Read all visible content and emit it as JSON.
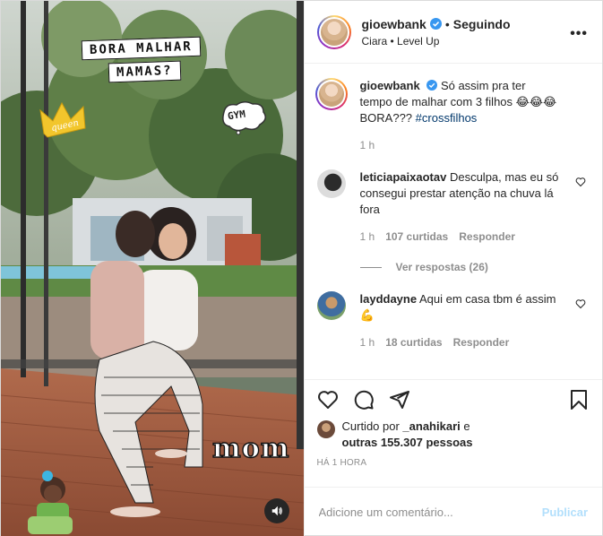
{
  "media": {
    "sticker_line1": "BORA MALHAR",
    "sticker_line2": "MAMAS?",
    "sticker_gym": "GYM",
    "sticker_queen": "queen",
    "sticker_mom": "mom"
  },
  "header": {
    "username": "gioewbank",
    "separator": "•",
    "follow_status": "Seguindo",
    "song": "Ciara • Level Up",
    "more_icon": "more-horizontal-icon"
  },
  "caption": {
    "username": "gioewbank",
    "text": "Só assim pra ter tempo de malhar com 3 filhos 😂😂😂 BORA??? ",
    "hashtag": "#crossfilhos",
    "time": "1 h"
  },
  "comments": [
    {
      "username": "leticiapaixaotav",
      "text": "Desculpa, mas eu só consegui prestar atenção na chuva lá fora",
      "time": "1 h",
      "likes": "107 curtidas",
      "reply": "Responder",
      "view_replies": "Ver respostas (26)"
    },
    {
      "username": "layddayne",
      "text": "Aqui em casa tbm é assim💪",
      "time": "1 h",
      "likes": "18 curtidas",
      "reply": "Responder"
    }
  ],
  "likes": {
    "prefix": "Curtido por ",
    "user": "_anahikari",
    "middle": " e ",
    "others": "outras 155.307 pessoas"
  },
  "posted_ago": "HÁ 1 HORA",
  "add_comment": {
    "placeholder": "Adicione um comentário...",
    "publish_label": "Publicar"
  },
  "colors": {
    "link": "#00376b",
    "publish_disabled": "#b2dffc",
    "verified": "#3897f0",
    "muted_text": "#8e8e8e"
  }
}
